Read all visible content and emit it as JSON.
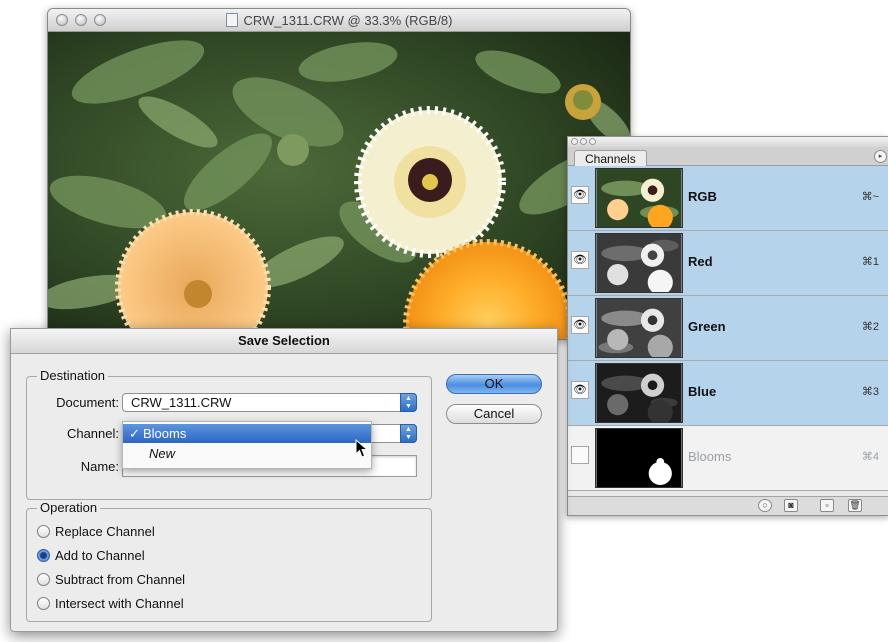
{
  "document_window": {
    "title": "CRW_1311.CRW @ 33.3% (RGB/8)"
  },
  "channels_panel": {
    "tab_label": "Channels",
    "rows": [
      {
        "name": "RGB",
        "shortcut": "⌘~",
        "visible": true,
        "selected": true
      },
      {
        "name": "Red",
        "shortcut": "⌘1",
        "visible": true,
        "selected": true
      },
      {
        "name": "Green",
        "shortcut": "⌘2",
        "visible": true,
        "selected": true
      },
      {
        "name": "Blue",
        "shortcut": "⌘3",
        "visible": true,
        "selected": true
      },
      {
        "name": "Blooms",
        "shortcut": "⌘4",
        "visible": false,
        "selected": false
      }
    ],
    "footer_icons": [
      "load-selection-icon",
      "save-selection-icon",
      "new-channel-icon",
      "trash-icon"
    ]
  },
  "save_selection_dialog": {
    "title": "Save Selection",
    "destination": {
      "group_label": "Destination",
      "document_label": "Document:",
      "document_value": "CRW_1311.CRW",
      "channel_label": "Channel:",
      "channel_options": [
        {
          "label": "Blooms",
          "checked": true,
          "check_glyph": "✓"
        },
        {
          "label": "New",
          "checked": false
        }
      ],
      "name_label": "Name:",
      "name_value": ""
    },
    "operation": {
      "group_label": "Operation",
      "options": [
        {
          "label": "Replace Channel",
          "selected": false
        },
        {
          "label": "Add to Channel",
          "selected": true
        },
        {
          "label": "Subtract from Channel",
          "selected": false
        },
        {
          "label": "Intersect with Channel",
          "selected": false
        }
      ]
    },
    "buttons": {
      "ok": "OK",
      "cancel": "Cancel"
    }
  },
  "colors": {
    "selected_row": "#b6d3ec",
    "default_button": "#4c8fe0",
    "menu_highlight": "#2c66c3"
  }
}
